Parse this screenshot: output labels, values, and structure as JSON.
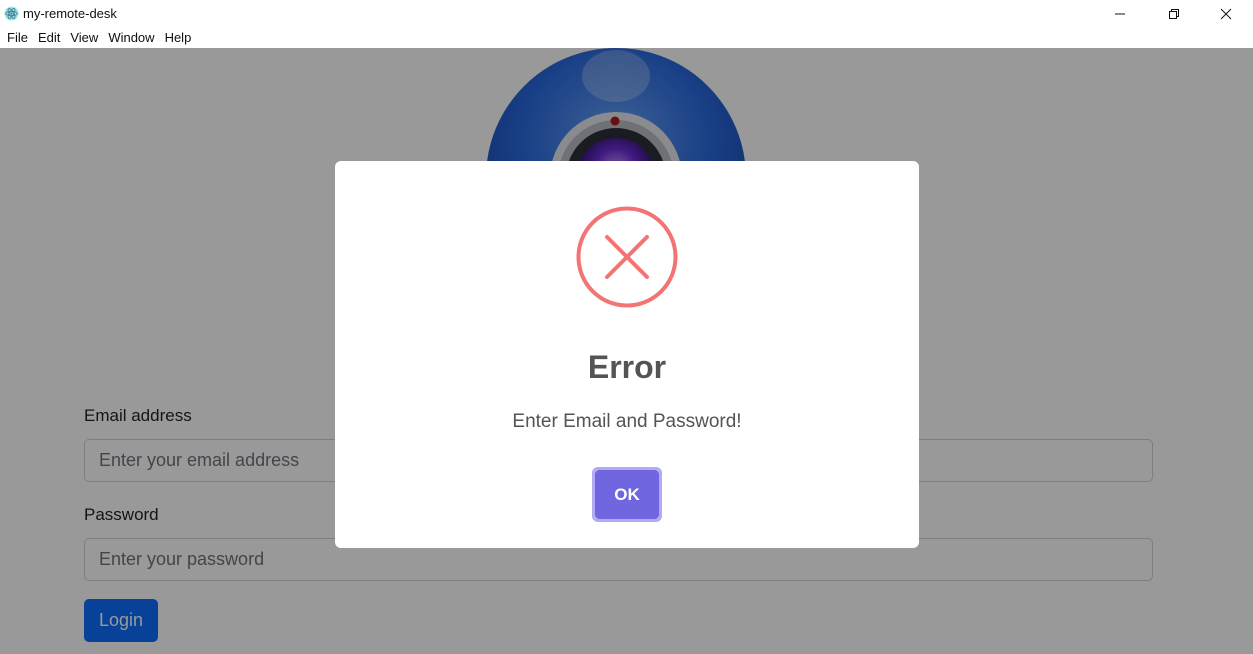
{
  "window": {
    "title": "my-remote-desk",
    "minimize_icon": "minimize-icon",
    "maximize_icon": "restore-icon",
    "close_icon": "close-icon"
  },
  "menu": {
    "items": [
      "File",
      "Edit",
      "View",
      "Window",
      "Help"
    ]
  },
  "form": {
    "email_label": "Email address",
    "email_placeholder": "Enter your email address",
    "email_value": "",
    "password_label": "Password",
    "password_placeholder": "Enter your password",
    "password_value": "",
    "login_label": "Login"
  },
  "dialog": {
    "icon": "error-x-icon",
    "title": "Error",
    "message": "Enter Email and Password!",
    "ok_label": "OK"
  },
  "colors": {
    "overlay": "rgba(0,0,0,0.4)",
    "error": "#f27474",
    "confirm_button": "#7066e0",
    "login_button": "#0d6efd"
  }
}
